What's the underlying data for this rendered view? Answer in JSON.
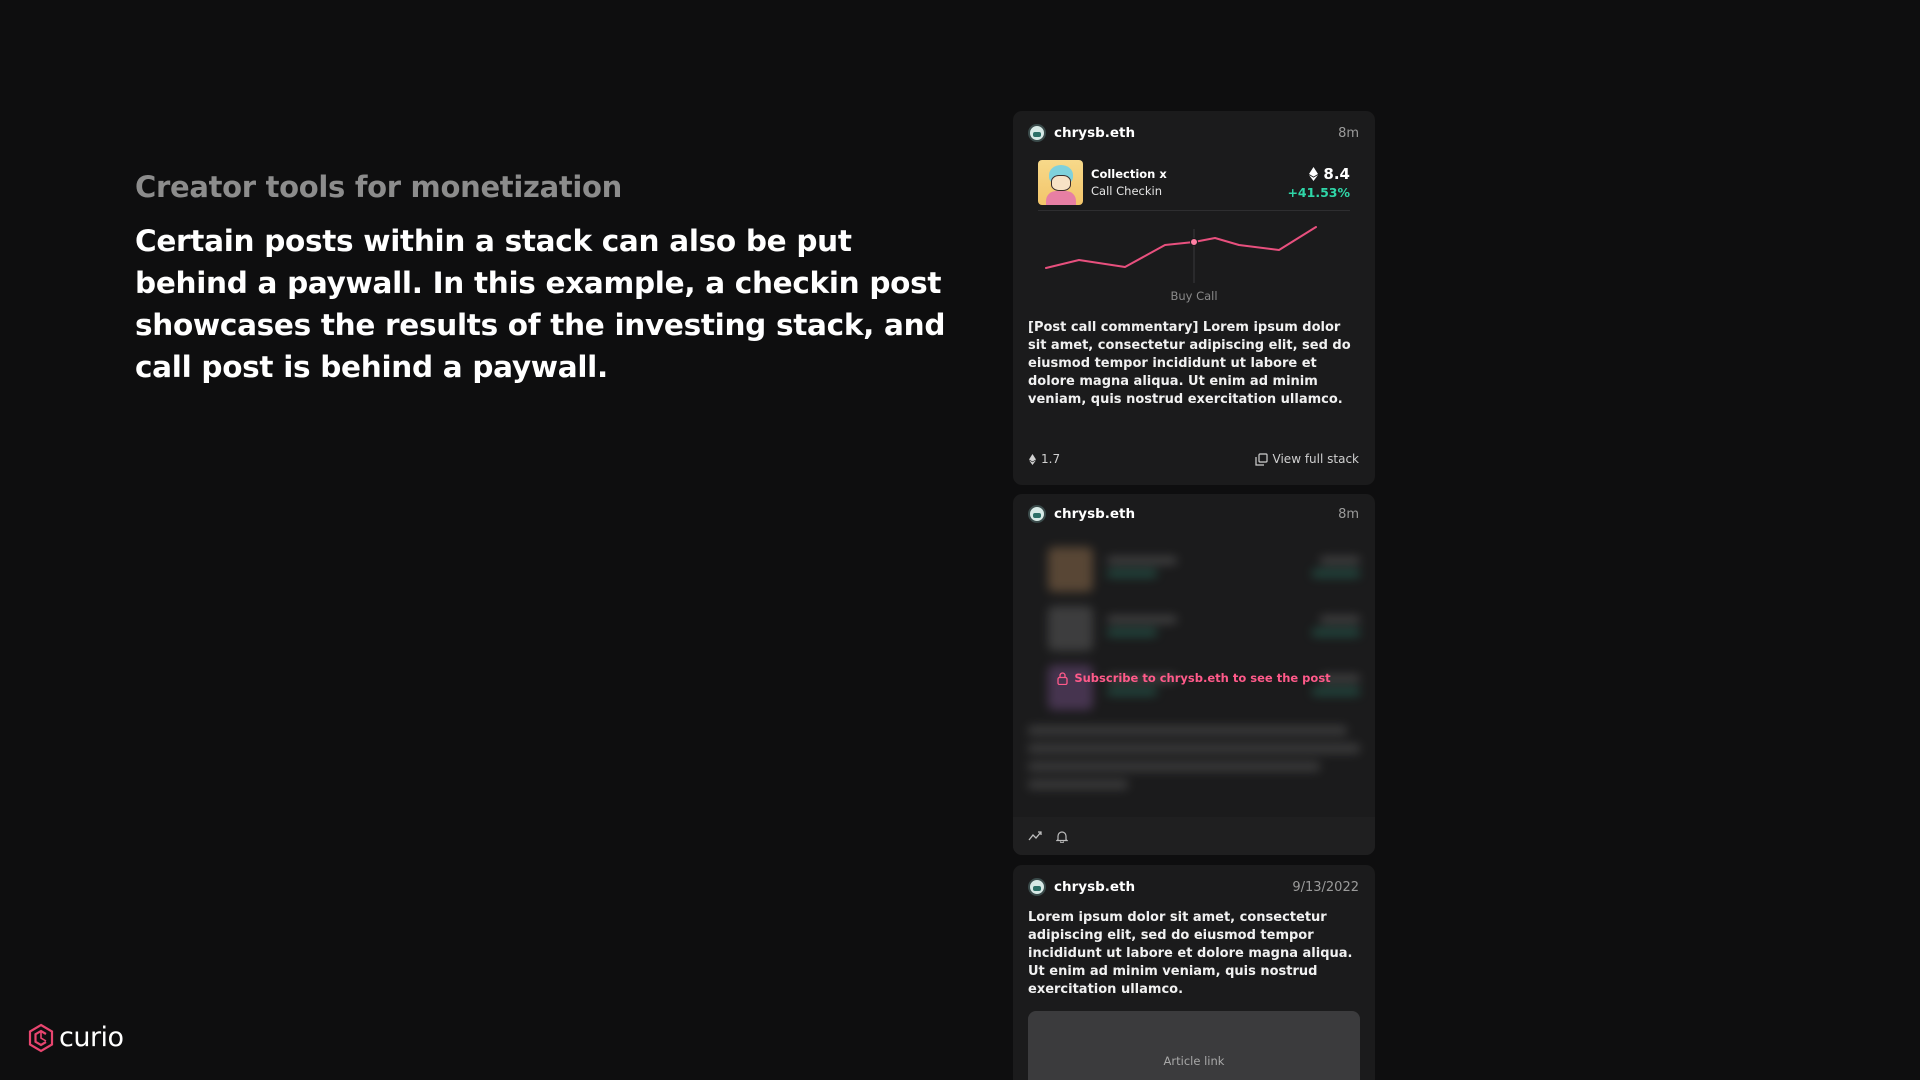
{
  "left": {
    "subtitle": "Creator tools for monetization",
    "body": "Certain posts within a stack can also be put behind a paywall. In this example, a checkin post showcases the results of the investing stack, and call post is behind a paywall."
  },
  "brand": {
    "name": "curio",
    "accent": "#e8456f"
  },
  "feed": {
    "card1": {
      "user": "chrysb.eth",
      "time": "8m",
      "collection_name": "Collection x",
      "collection_sub": "Call Checkin",
      "price": "8.4",
      "price_change": "+41.53%",
      "chart_label": "Buy Call",
      "text": "[Post call commentary] Lorem ipsum dolor sit amet, consectetur adipiscing elit, sed do eiusmod tempor incididunt ut labore et dolore magna aliqua. Ut enim ad minim veniam, quis nostrud exercitation ullamco.",
      "tip_amount": "1.7",
      "view_stack_label": "View full stack",
      "line_color": "#e8507e",
      "change_color": "#2fd6a8"
    },
    "card2": {
      "user": "chrysb.eth",
      "time": "8m",
      "lock_message": "Subscribe to chrysb.eth to see the post",
      "lock_color": "#ff5a8a"
    },
    "card3": {
      "user": "chrysb.eth",
      "time": "9/13/2022",
      "text": "Lorem ipsum dolor sit amet, consectetur adipiscing elit, sed do eiusmod tempor incididunt ut labore et dolore magna aliqua. Ut enim ad minim veniam, quis nostrud exercitation ullamco.",
      "article_label": "Article link"
    }
  }
}
